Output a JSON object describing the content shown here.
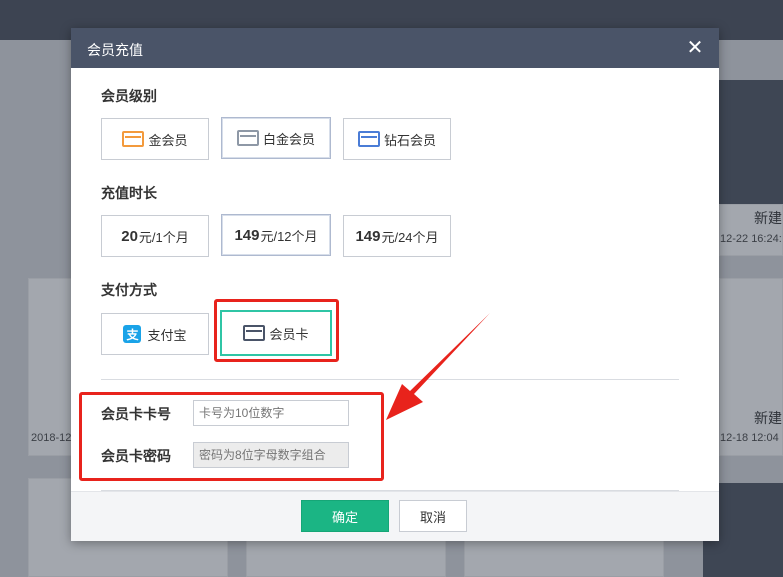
{
  "modal": {
    "title": "会员充值",
    "close_icon": "close-icon",
    "level": {
      "label": "会员级别",
      "options": [
        {
          "label": "金会员",
          "icon": "gold-card-icon",
          "color": "#f39a3c"
        },
        {
          "label": "白金会员",
          "icon": "platinum-card-icon",
          "color": "#8e98a6",
          "selected": true
        },
        {
          "label": "钻石会员",
          "icon": "diamond-card-icon",
          "color": "#4a7cd6"
        }
      ]
    },
    "duration": {
      "label": "充值时长",
      "options": [
        {
          "price": "20",
          "rest": "元/1个月"
        },
        {
          "price": "149",
          "rest": "元/12个月",
          "selected": true
        },
        {
          "price": "149",
          "rest": "元/24个月"
        }
      ]
    },
    "payment": {
      "label": "支付方式",
      "options": [
        {
          "label": "支付宝",
          "icon": "alipay-icon",
          "glyph": "支"
        },
        {
          "label": "会员卡",
          "icon": "member-card-icon",
          "selected": true
        }
      ]
    },
    "card_number": {
      "label": "会员卡卡号",
      "placeholder": "卡号为10位数字"
    },
    "card_password": {
      "label": "会员卡密码",
      "placeholder": "密码为8位字母数字组合"
    },
    "buttons": {
      "confirm": "确定",
      "cancel": "取消"
    }
  },
  "background": {
    "card_titles": [
      "新建",
      "新建"
    ],
    "timestamps": [
      "12-22 16:24:",
      "2018-12",
      "12-18 12:04"
    ]
  },
  "colors": {
    "accent": "#1bb584",
    "header": "#4a5468",
    "annotation": "#e8231c",
    "selected_border": "#2fc5a5"
  }
}
